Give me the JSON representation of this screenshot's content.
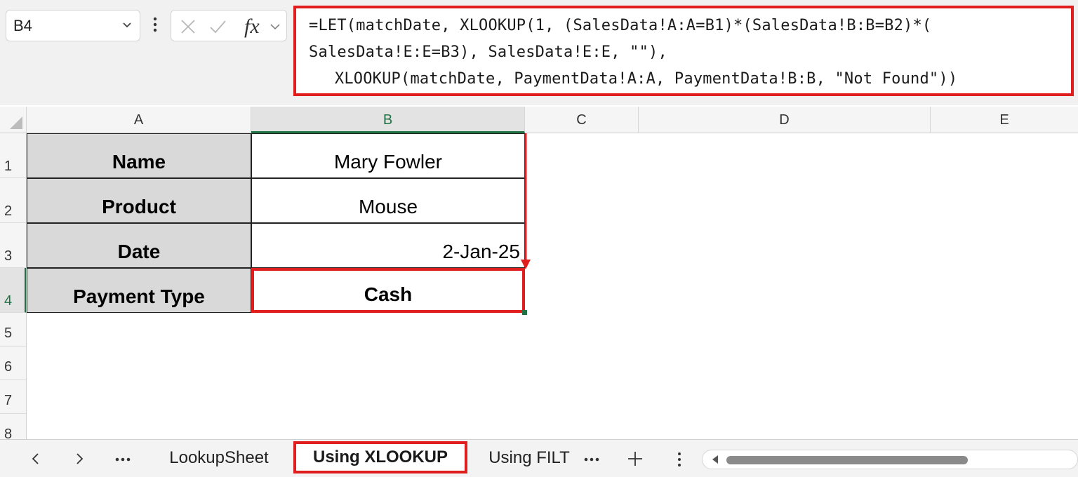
{
  "formula_bar": {
    "name_box": "B4",
    "fx_label": "fx",
    "formula_lines": [
      "=LET(matchDate, XLOOKUP(1, (SalesData!A:A=B1)*(SalesData!B:B=B2)*(",
      "SalesData!E:E=B3), SalesData!E:E, \"\"),",
      "  XLOOKUP(matchDate, PaymentData!A:A, PaymentData!B:B, \"Not Found\"))"
    ]
  },
  "grid": {
    "columns": [
      "A",
      "B",
      "C",
      "D",
      "E"
    ],
    "rows": [
      "1",
      "2",
      "3",
      "4",
      "5",
      "6",
      "7",
      "8"
    ],
    "active_cell": "B4",
    "cells": [
      {
        "label": "Name",
        "value": "Mary Fowler"
      },
      {
        "label": "Product",
        "value": "Mouse"
      },
      {
        "label": "Date",
        "value": "2-Jan-25"
      },
      {
        "label": "Payment Type",
        "value": "Cash"
      }
    ]
  },
  "sheet_tabs": {
    "tabs": [
      "LookupSheet",
      "Using XLOOKUP",
      "Using FILT"
    ],
    "active": "Using XLOOKUP"
  },
  "icons": {
    "prev": "chevron-left-icon",
    "next": "chevron-right-icon",
    "more": "ellipsis-icon",
    "add": "plus-icon",
    "options": "vertical-dots-icon"
  },
  "colors": {
    "highlight": "#e01e1e",
    "label_fill": "#d9d9d9",
    "active_header": "#217346"
  }
}
